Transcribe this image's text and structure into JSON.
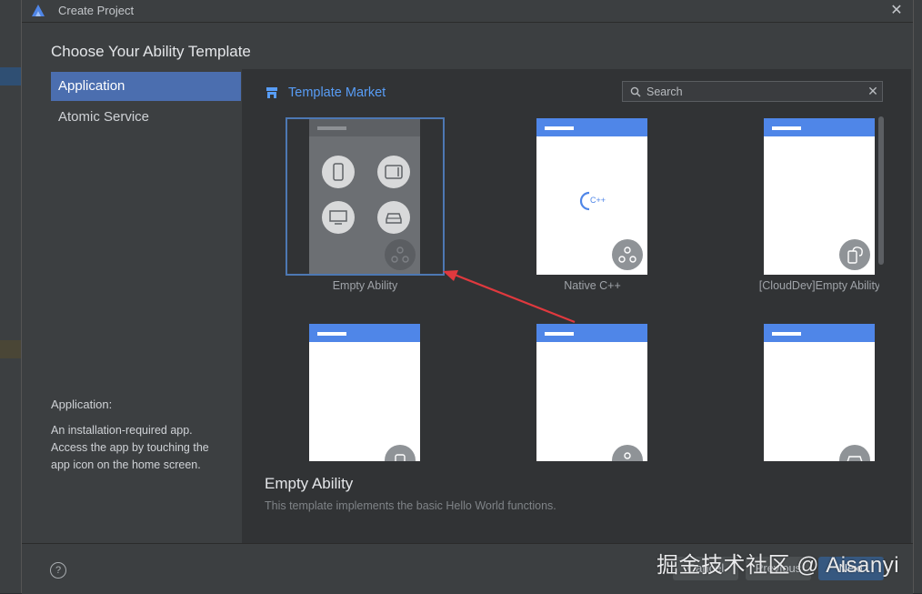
{
  "window": {
    "title": "Create Project",
    "close_icon": "close-icon"
  },
  "heading": "Choose Your Ability Template",
  "sidebar": {
    "items": [
      {
        "label": "Application",
        "active": true
      },
      {
        "label": "Atomic Service",
        "active": false
      }
    ],
    "description_title": "Application:",
    "description_text": "An installation-required app. Access the app by touching the app icon on the home screen."
  },
  "market": {
    "label": "Template Market",
    "icon": "store-icon"
  },
  "search": {
    "placeholder": "Search",
    "value": ""
  },
  "templates": [
    {
      "label": "Empty Ability",
      "selected": true
    },
    {
      "label": "Native C++",
      "selected": false
    },
    {
      "label": "[CloudDev]Empty Ability",
      "selected": false
    },
    {
      "label": "",
      "selected": false
    },
    {
      "label": "",
      "selected": false
    },
    {
      "label": "",
      "selected": false
    }
  ],
  "native_mark": "C++",
  "detail": {
    "title": "Empty Ability",
    "description": "This template implements the basic Hello World functions."
  },
  "footer": {
    "help": "?",
    "cancel_label": "Cancel",
    "previous_label": "Previous",
    "next_label": "Next"
  },
  "watermark": "掘金技术社区 @ Aisanyi",
  "colors": {
    "accent": "#4b6eaf",
    "link": "#589df6",
    "thumb_bar": "#4f86e8",
    "arrow": "#e0393e"
  }
}
